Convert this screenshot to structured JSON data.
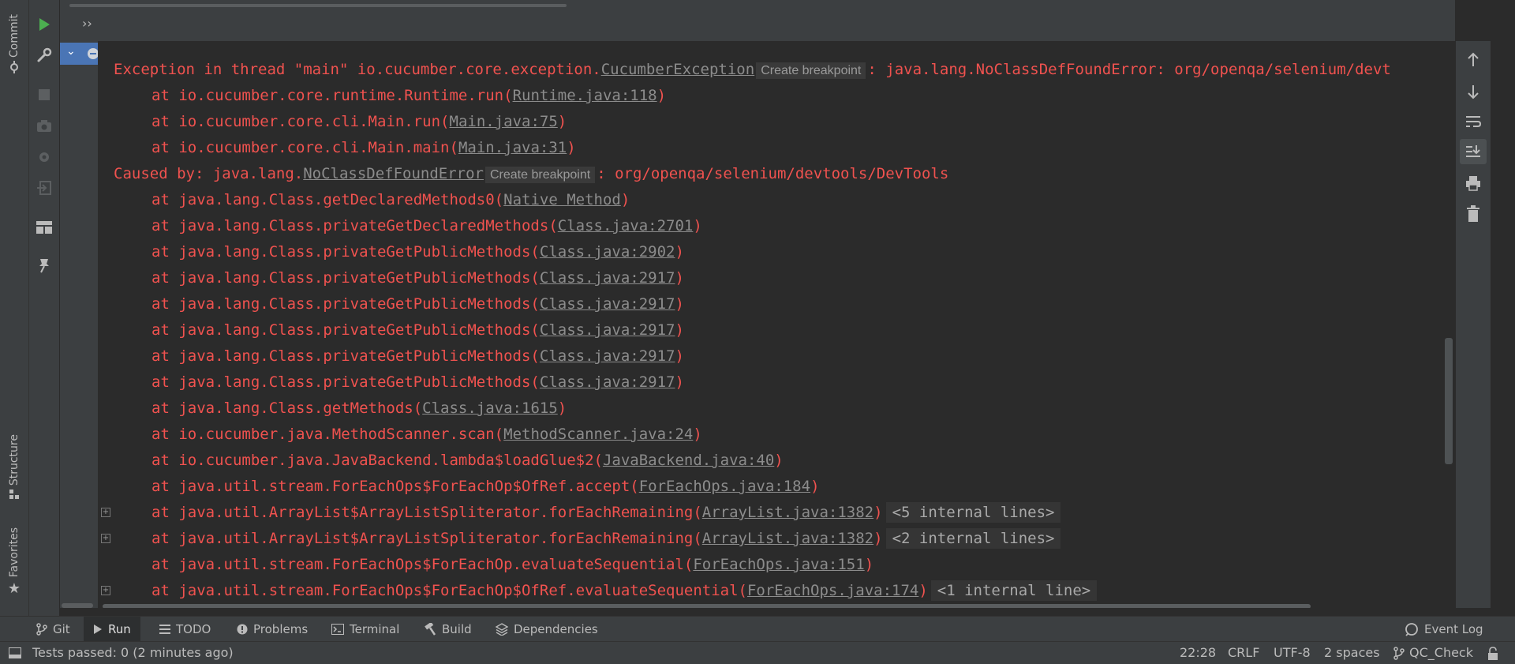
{
  "left_stripe": {
    "commit_label": "Commit",
    "structure_label": "Structure",
    "favorites_label": "Favorites"
  },
  "console_header": {
    "more_glyph": "››"
  },
  "console": {
    "lines": [
      {
        "pre": "Exception in thread \"main\" io.cucumber.core.exception.",
        "link": "CucumberException",
        "chip": "Create breakpoint",
        "post": ": java.lang.NoClassDefFoundError: org/openqa/selenium/devt"
      },
      {
        "pre": "at io.cucumber.core.runtime.Runtime.run(",
        "link": "Runtime.java:118",
        "post": ")"
      },
      {
        "pre": "at io.cucumber.core.cli.Main.run(",
        "link": "Main.java:75",
        "post": ")"
      },
      {
        "pre": "at io.cucumber.core.cli.Main.main(",
        "link": "Main.java:31",
        "post": ")"
      },
      {
        "pre": "Caused by: java.lang.",
        "link": "NoClassDefFoundError",
        "chip": "Create breakpoint",
        "post": ": org/openqa/selenium/devtools/DevTools"
      },
      {
        "pre": "at java.lang.Class.getDeclaredMethods0(",
        "link": "Native Method",
        "post": ")"
      },
      {
        "pre": "at java.lang.Class.privateGetDeclaredMethods(",
        "link": "Class.java:2701",
        "post": ")"
      },
      {
        "pre": "at java.lang.Class.privateGetPublicMethods(",
        "link": "Class.java:2902",
        "post": ")"
      },
      {
        "pre": "at java.lang.Class.privateGetPublicMethods(",
        "link": "Class.java:2917",
        "post": ")"
      },
      {
        "pre": "at java.lang.Class.privateGetPublicMethods(",
        "link": "Class.java:2917",
        "post": ")"
      },
      {
        "pre": "at java.lang.Class.privateGetPublicMethods(",
        "link": "Class.java:2917",
        "post": ")"
      },
      {
        "pre": "at java.lang.Class.privateGetPublicMethods(",
        "link": "Class.java:2917",
        "post": ")"
      },
      {
        "pre": "at java.lang.Class.privateGetPublicMethods(",
        "link": "Class.java:2917",
        "post": ")"
      },
      {
        "pre": "at java.lang.Class.getMethods(",
        "link": "Class.java:1615",
        "post": ")"
      },
      {
        "pre": "at io.cucumber.java.MethodScanner.scan(",
        "link": "MethodScanner.java:24",
        "post": ")"
      },
      {
        "pre": "at io.cucumber.java.JavaBackend.lambda$loadGlue$2(",
        "link": "JavaBackend.java:40",
        "post": ")"
      },
      {
        "pre": "at java.util.stream.ForEachOps$ForEachOp$OfRef.accept(",
        "link": "ForEachOps.java:184",
        "post": ")"
      },
      {
        "pre": "at java.util.ArrayList$ArrayListSpliterator.forEachRemaining(",
        "link": "ArrayList.java:1382",
        "post": ")",
        "internal": "<5 internal lines>"
      },
      {
        "pre": "at java.util.ArrayList$ArrayListSpliterator.forEachRemaining(",
        "link": "ArrayList.java:1382",
        "post": ")",
        "internal": "<2 internal lines>"
      },
      {
        "pre": "at java.util.stream.ForEachOps$ForEachOp.evaluateSequential(",
        "link": "ForEachOps.java:151",
        "post": ")"
      },
      {
        "pre": "at java.util.stream.ForEachOps$ForEachOp$OfRef.evaluateSequential(",
        "link": "ForEachOps.java:174",
        "post": ")",
        "internal": "<1 internal line>"
      }
    ]
  },
  "bottom_tabs": [
    {
      "label": "Git",
      "icon": "git-branch-icon"
    },
    {
      "label": "Run",
      "icon": "run-icon",
      "active": true
    },
    {
      "label": "TODO",
      "icon": "list-icon"
    },
    {
      "label": "Problems",
      "icon": "info-icon"
    },
    {
      "label": "Terminal",
      "icon": "terminal-icon"
    },
    {
      "label": "Build",
      "icon": "hammer-icon"
    },
    {
      "label": "Dependencies",
      "icon": "layers-icon"
    }
  ],
  "event_log_label": "Event Log",
  "status_bar": {
    "message": "Tests passed: 0 (2 minutes ago)",
    "position": "22:28",
    "line_sep": "CRLF",
    "encoding": "UTF-8",
    "indent": "2 spaces",
    "branch": "QC_Check"
  },
  "colors": {
    "error_text": "#f0524f",
    "link_text": "#8c8c8c",
    "run_green": "#4caf50",
    "selection_blue": "#4a75b5"
  }
}
